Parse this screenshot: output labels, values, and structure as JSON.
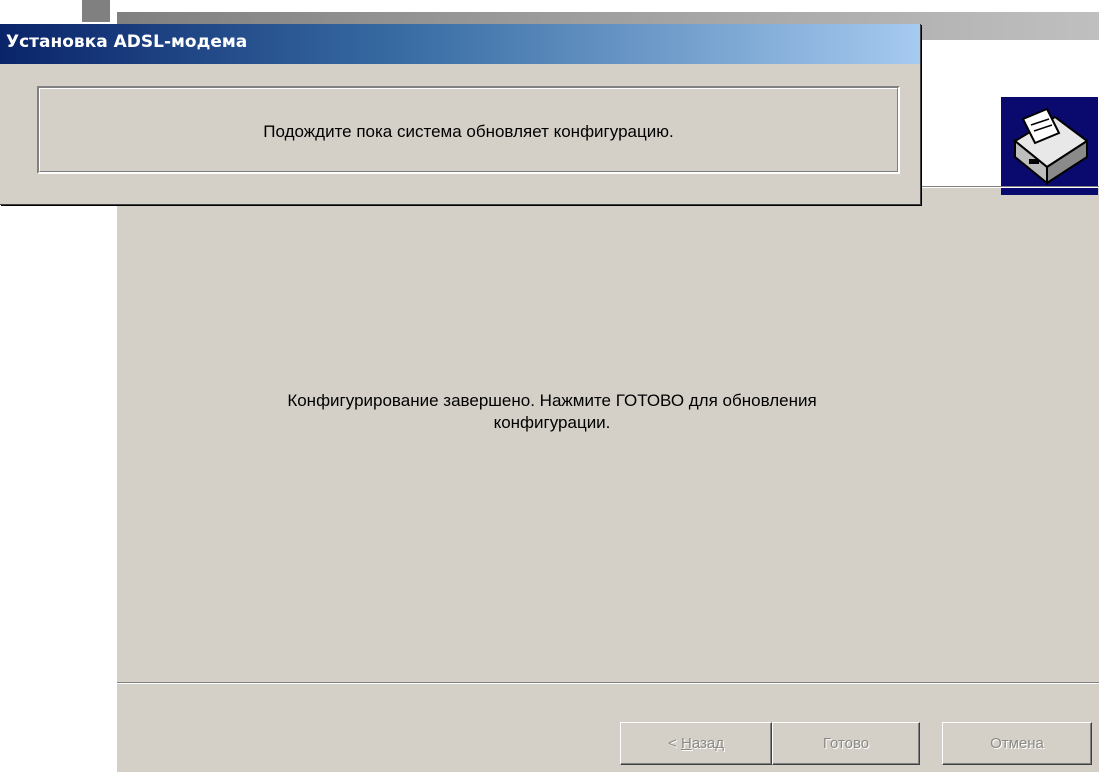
{
  "wizard": {
    "message_line1": "Конфигурирование завершено. Нажмите ГОТОВО для обновления",
    "message_line2": "конфигурации.",
    "buttons": {
      "back": {
        "prefix": "< ",
        "mnemonic": "Н",
        "rest": "азад",
        "enabled": false
      },
      "finish": {
        "label": "Готово",
        "enabled": false
      },
      "cancel": {
        "label": "Отмена",
        "enabled": false
      }
    },
    "header_icon": "hardware-install-icon"
  },
  "dialog": {
    "title": "Установка ADSL-модема",
    "message": "Подождите пока система обновляет конфигурацию."
  },
  "colors": {
    "face": "#d4d0c8",
    "title_active_start": "#0a246a",
    "title_active_end": "#a6caf0",
    "disabled_text": "#8c8a86"
  }
}
